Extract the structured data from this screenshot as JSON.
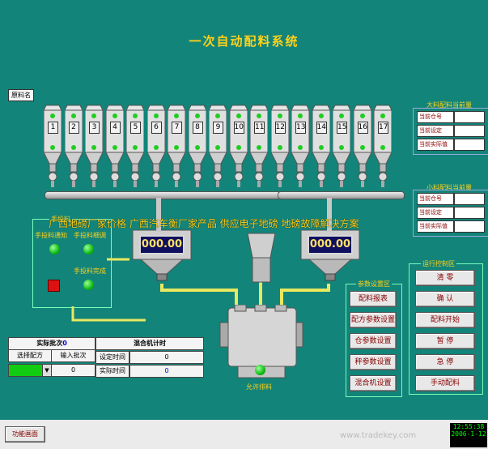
{
  "title": "一次自动配料系统",
  "raw_material_label": "原料名",
  "silos": [
    "1",
    "2",
    "3",
    "4",
    "5",
    "6",
    "7",
    "8",
    "9",
    "10",
    "11",
    "12",
    "13",
    "14",
    "15",
    "16",
    "17"
  ],
  "big_panel": {
    "title": "大料配料当前量",
    "rows": [
      "当前仓号",
      "当前设定",
      "当前实际值"
    ]
  },
  "small_panel": {
    "title": "小料配料当前量",
    "rows": [
      "当前仓号",
      "当前设定",
      "当前实际值"
    ]
  },
  "manual_panel": {
    "title": "手投料",
    "notify": "手投料通知",
    "fine": "手投料细调",
    "done": "手投料完成"
  },
  "scale_left": "000.00",
  "scale_right": "000.00",
  "param_panel": {
    "title": "参数设置区",
    "buttons": [
      "配料报表",
      "配方参数设置",
      "仓参数设置",
      "秤参数设置",
      "混合机设置"
    ]
  },
  "run_panel": {
    "title": "运行控制区",
    "buttons": [
      "清 零",
      "确 认",
      "配料开始",
      "暂 停",
      "急 停",
      "手动配料"
    ]
  },
  "mixer_label": "允许排料",
  "batch_table": {
    "actual_batch_label": "实际批次",
    "actual_batch_value": "0",
    "select_label": "选择配方",
    "input_label": "输入批次",
    "input_value": "0"
  },
  "mixer_timer": {
    "title": "混合机计时",
    "set_label": "设定时间",
    "set_value": "0",
    "actual_label": "实际时间",
    "actual_value": "0"
  },
  "watermark": "广西地磅厂家价格 广西汽车衡厂家产品 供应电子地磅 地磅故障解决方案",
  "bottom_button": "功能画面",
  "clock": {
    "time": "12:55:38",
    "date": "2006-1-12"
  },
  "site_watermark": "www.tradekey.com",
  "colors": {
    "background": "#138479",
    "title": "#ffd11a",
    "indicator": "#22bb22",
    "alarm": "#dd1111"
  }
}
